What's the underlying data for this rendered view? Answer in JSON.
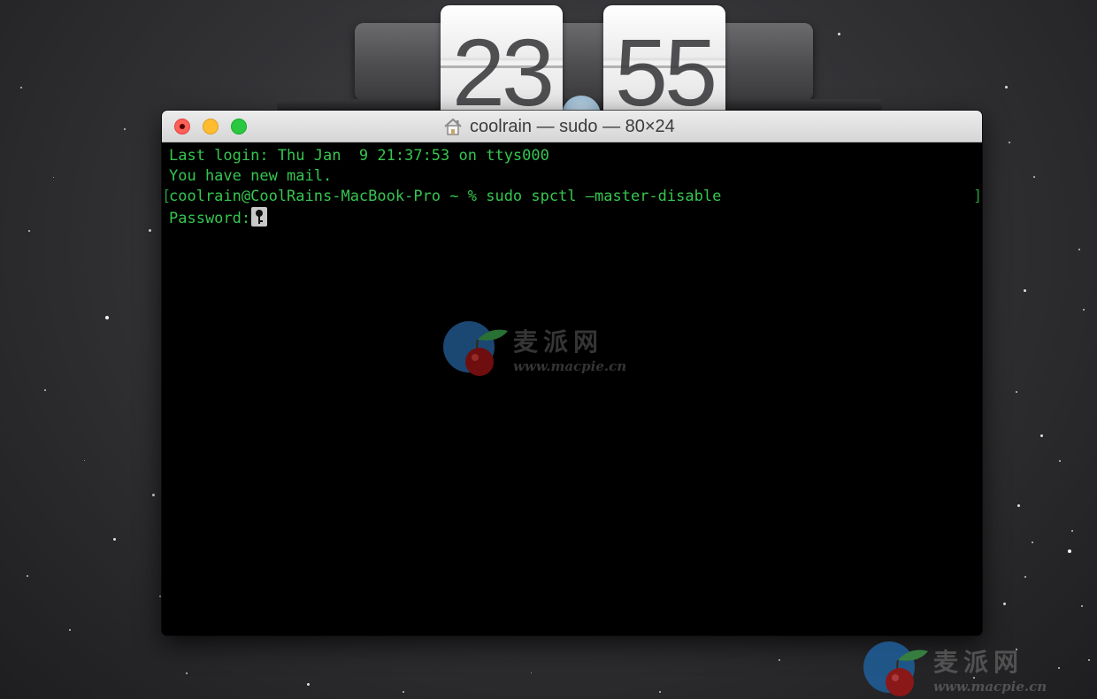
{
  "clock": {
    "hours": "23",
    "minutes": "55"
  },
  "terminal": {
    "title": "coolrain — sudo — 80×24",
    "title_icon": "home-icon",
    "lines": {
      "last_login": "Last login: Thu Jan  9 21:37:53 on ttys000",
      "mail": "You have new mail.",
      "prompt": "coolrain@CoolRains-MacBook-Pro ~ % sudo spctl —master-disable",
      "password": "Password:"
    },
    "cursor_icon": "key-icon",
    "colors": {
      "text": "#35c64f",
      "background": "#000000",
      "close": "#fe5f57",
      "minimize": "#febc2e",
      "maximize": "#28c840"
    }
  },
  "watermark": {
    "brand": "麦派网",
    "url": "www.macpie.cn",
    "icon": "cherry-logo-icon"
  }
}
